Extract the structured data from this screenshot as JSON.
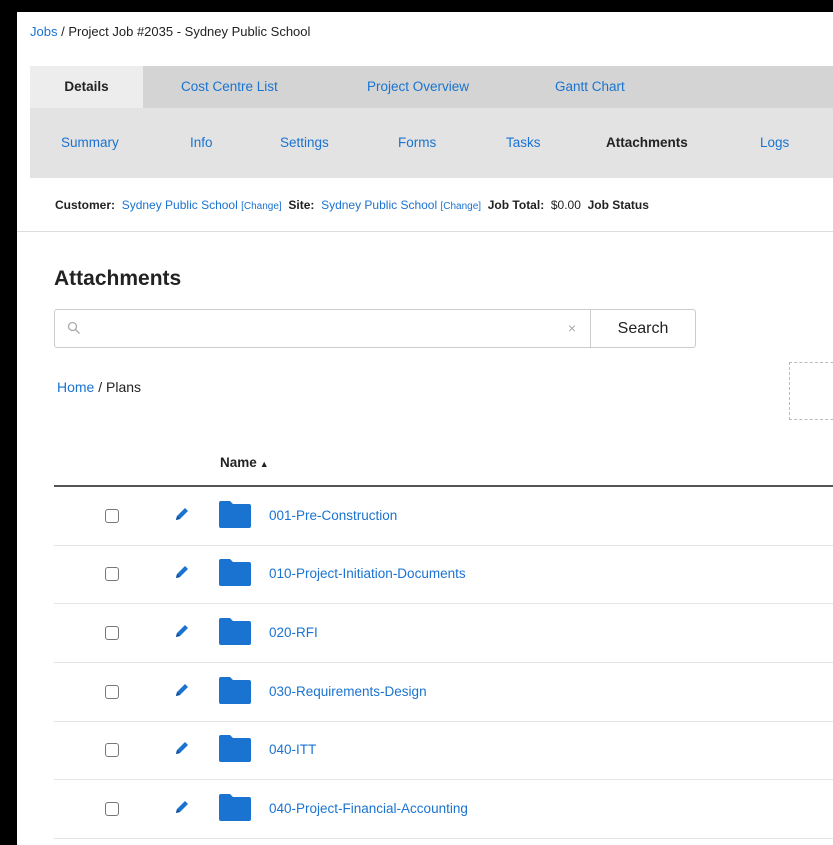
{
  "breadcrumb": {
    "root": "Jobs",
    "separator": " / ",
    "current": "Project Job #2035 - Sydney Public School"
  },
  "tabs": [
    {
      "label": "Details",
      "active": true
    },
    {
      "label": "Cost Centre List",
      "active": false
    },
    {
      "label": "Project Overview",
      "active": false
    },
    {
      "label": "Gantt Chart",
      "active": false
    }
  ],
  "subtabs": [
    {
      "label": "Summary",
      "active": false
    },
    {
      "label": "Info",
      "active": false
    },
    {
      "label": "Settings",
      "active": false
    },
    {
      "label": "Forms",
      "active": false
    },
    {
      "label": "Tasks",
      "active": false
    },
    {
      "label": "Attachments",
      "active": true
    },
    {
      "label": "Logs",
      "active": false
    }
  ],
  "info": {
    "customer_label": "Customer:",
    "customer_value": "Sydney Public School",
    "site_label": "Site:",
    "site_value": "Sydney Public School",
    "change_label": "[Change]",
    "job_total_label": "Job Total:",
    "job_total_value": "$0.00",
    "job_status_label": "Job Status"
  },
  "page_title": "Attachments",
  "search": {
    "value": "",
    "placeholder": "",
    "clear_glyph": "×",
    "button_label": "Search"
  },
  "path": {
    "home": "Home",
    "separator": " / ",
    "current": "Plans"
  },
  "table": {
    "name_header": "Name",
    "sort_indicator": "▲",
    "rows": [
      {
        "name": "001-Pre-Construction"
      },
      {
        "name": "010-Project-Initiation-Documents"
      },
      {
        "name": "020-RFI"
      },
      {
        "name": "030-Requirements-Design"
      },
      {
        "name": "040-ITT"
      },
      {
        "name": "040-Project-Financial-Accounting"
      }
    ]
  },
  "colors": {
    "link": "#1a73d0",
    "folder": "#1a73d0",
    "tab_bar": "#d4d4d4",
    "frame": "#000000"
  }
}
